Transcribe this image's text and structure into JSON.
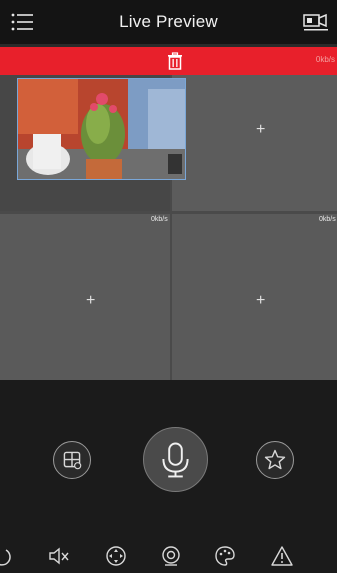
{
  "header": {
    "title": "Live Preview",
    "menu_icon": "list-menu-icon",
    "camera_icon": "camera-record-icon"
  },
  "delete_bar": {
    "icon": "trash-icon",
    "faint_rate": "0kb/s",
    "color": "#e8202b"
  },
  "grid": {
    "cells": [
      {
        "id": "window-1",
        "state": "live-video"
      },
      {
        "id": "window-2",
        "state": "empty",
        "add_label": "+"
      },
      {
        "id": "window-3",
        "state": "empty",
        "add_label": "+",
        "rate": "0kb/s"
      },
      {
        "id": "window-4",
        "state": "empty",
        "add_label": "+",
        "rate": "0kb/s"
      }
    ]
  },
  "controls": {
    "layout_icon": "layout-grid-icon",
    "talk_icon": "microphone-icon",
    "favorite_icon": "star-icon"
  },
  "toolbar": {
    "items": [
      "power-icon",
      "mute-icon",
      "ptz-direction-icon",
      "capture-icon",
      "image-settings-icon",
      "alarm-icon"
    ]
  }
}
